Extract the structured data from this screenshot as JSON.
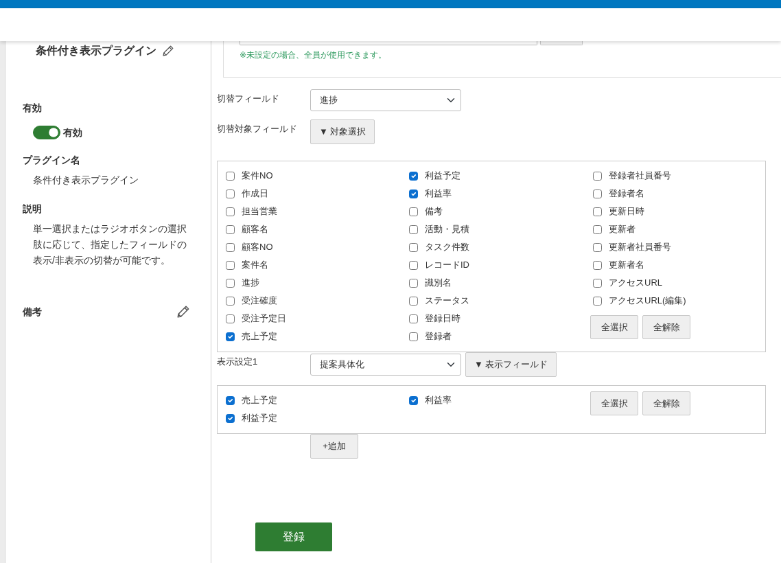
{
  "sidebar": {
    "title": "条件付き表示プラグイン",
    "sections": [
      {
        "kind": "toggle",
        "label": "有効",
        "toggle": {
          "on": true,
          "label": "有効"
        }
      },
      {
        "kind": "text",
        "label": "プラグイン名",
        "value": "条件付き表示プラグイン"
      },
      {
        "kind": "text",
        "label": "説明",
        "value": "単一選択またはラジオボタンの選択肢に応じて、指定したフィールドの表示/非表示の切替が可能です。"
      },
      {
        "kind": "editable",
        "label": "備考"
      }
    ]
  },
  "access_panel": {
    "hint": "※未設定の場合、全員が使用できます。"
  },
  "switch_field": {
    "label": "切替フィールド",
    "value": "進捗"
  },
  "target_fields": {
    "label": "切替対象フィールド",
    "toggle_button": "▼ 対象選択",
    "columns": [
      {
        "items": [
          {
            "label": "案件NO",
            "checked": false
          },
          {
            "label": "作成日",
            "checked": false
          },
          {
            "label": "担当営業",
            "checked": false
          },
          {
            "label": "顧客名",
            "checked": false
          },
          {
            "label": "顧客NO",
            "checked": false
          },
          {
            "label": "案件名",
            "checked": false
          },
          {
            "label": "進捗",
            "checked": false
          },
          {
            "label": "受注確度",
            "checked": false
          },
          {
            "label": "受注予定日",
            "checked": false
          },
          {
            "label": "売上予定",
            "checked": true
          }
        ]
      },
      {
        "items": [
          {
            "label": "利益予定",
            "checked": true
          },
          {
            "label": "利益率",
            "checked": true
          },
          {
            "label": "備考",
            "checked": false
          },
          {
            "label": "活動・見積",
            "checked": false
          },
          {
            "label": "タスク件数",
            "checked": false
          },
          {
            "label": "レコードID",
            "checked": false
          },
          {
            "label": "識別名",
            "checked": false
          },
          {
            "label": "ステータス",
            "checked": false
          },
          {
            "label": "登録日時",
            "checked": false
          },
          {
            "label": "登録者",
            "checked": false
          }
        ]
      },
      {
        "items": [
          {
            "label": "登録者社員番号",
            "checked": false
          },
          {
            "label": "登録者名",
            "checked": false
          },
          {
            "label": "更新日時",
            "checked": false
          },
          {
            "label": "更新者",
            "checked": false
          },
          {
            "label": "更新者社員番号",
            "checked": false
          },
          {
            "label": "更新者名",
            "checked": false
          },
          {
            "label": "アクセスURL",
            "checked": false
          },
          {
            "label": "アクセスURL(編集)",
            "checked": false
          }
        ]
      }
    ],
    "select_all": "全選択",
    "clear_all": "全解除"
  },
  "display_settings": [
    {
      "label": "表示設定1",
      "value": "提案具体化",
      "fields_button": "▼ 表示フィールド",
      "columns": [
        {
          "items": [
            {
              "label": "売上予定",
              "checked": true
            },
            {
              "label": "利益予定",
              "checked": true
            }
          ]
        },
        {
          "items": [
            {
              "label": "利益率",
              "checked": true
            }
          ]
        }
      ],
      "select_all": "全選択",
      "clear_all": "全解除"
    }
  ],
  "add_button": "+追加",
  "submit_button": "登録"
}
